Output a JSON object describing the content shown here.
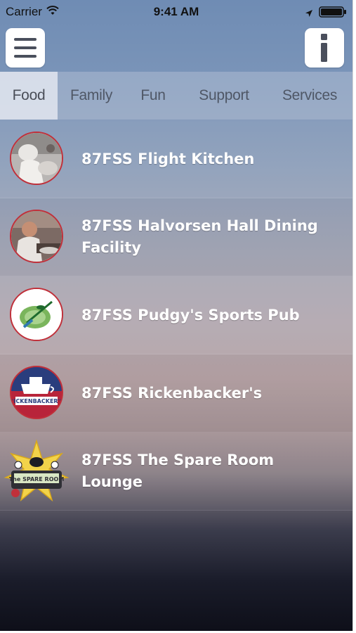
{
  "status_bar": {
    "carrier": "Carrier",
    "time": "9:41 AM",
    "wifi_icon": "wifi-icon",
    "location_icon": "location-arrow-icon",
    "battery_icon": "battery-icon"
  },
  "header": {
    "menu_icon": "hamburger-menu-icon",
    "info_icon": "info-icon"
  },
  "tabs": [
    {
      "label": "Food",
      "active": true
    },
    {
      "label": "Family",
      "active": false
    },
    {
      "label": "Fun",
      "active": false
    },
    {
      "label": "Support",
      "active": false
    },
    {
      "label": "Services",
      "active": false
    }
  ],
  "list": {
    "items": [
      {
        "label": "87FSS Flight Kitchen",
        "thumb": "chef-photo"
      },
      {
        "label": "87FSS Halvorsen Hall Dining Facility",
        "thumb": "dining-photo"
      },
      {
        "label": "87FSS Pudgy's Sports Pub",
        "thumb": "pub-logo"
      },
      {
        "label": "87FSS Rickenbacker's",
        "thumb": "rickenbackers-logo",
        "logo_text": "RICKENBACKER'S"
      },
      {
        "label": "87FSS The Spare Room Lounge",
        "thumb": "spare-room-logo",
        "logo_text": "The SPARE ROOM"
      }
    ]
  },
  "colors": {
    "tab_text": "#4f5766",
    "item_text": "#ffffff",
    "thumb_border": "#c0303a"
  }
}
